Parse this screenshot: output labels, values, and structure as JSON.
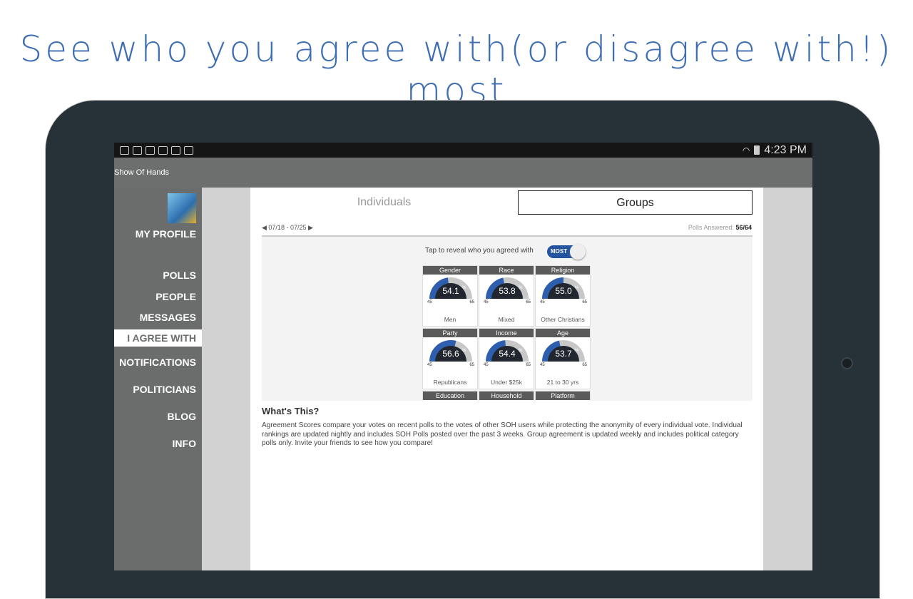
{
  "headline": "See who you agree with(or disagree with!) most",
  "status": {
    "time": "4:23 PM",
    "icons": [
      "cast-icon",
      "screen-clock-icon",
      "image-icon",
      "mail-icon",
      "clipboard-check-icon",
      "clipboard-play-icon"
    ]
  },
  "app": {
    "title": "Show Of Hands"
  },
  "sidebar": {
    "profile": "MY PROFILE",
    "items": [
      {
        "label": "POLLS"
      },
      {
        "label": "PEOPLE"
      },
      {
        "label": "MESSAGES"
      },
      {
        "label": "I AGREE WITH",
        "active": true
      },
      {
        "label": "NOTIFICATIONS"
      },
      {
        "label": "POLITICIANS"
      },
      {
        "label": "BLOG"
      },
      {
        "label": "INFO"
      }
    ]
  },
  "tabs": {
    "individuals": "Individuals",
    "groups": "Groups",
    "selected": "Groups"
  },
  "date_range": "07/18 - 07/25",
  "polls_answered_label": "Polls Answered:",
  "polls_answered": "56/64",
  "reveal_label": "Tap to reveal who you agreed with",
  "toggle_label": "MOST",
  "gauge_min": "45",
  "gauge_max": "65",
  "colors": {
    "accent": "#2e5fae",
    "gauge_track": "#c8c8c8",
    "gauge_center": "#22262e"
  },
  "groups": [
    {
      "category": "Gender",
      "value": "54.1",
      "label": "Men"
    },
    {
      "category": "Race",
      "value": "53.8",
      "label": "Mixed"
    },
    {
      "category": "Religion",
      "value": "55.0",
      "label": "Other Christians"
    },
    {
      "category": "Party",
      "value": "56.6",
      "label": "Republicans"
    },
    {
      "category": "Income",
      "value": "54.4",
      "label": "Under $25k"
    },
    {
      "category": "Age",
      "value": "53.7",
      "label": "21 to 30 yrs"
    },
    {
      "category": "Education"
    },
    {
      "category": "Household"
    },
    {
      "category": "Platform"
    }
  ],
  "whats_this": {
    "title": "What's This?",
    "text": "Agreement Scores compare your votes on recent polls to the votes of other SOH users while protecting the anonymity of every individual vote. Individual rankings are updated nightly and includes SOH Polls posted over the past 3 weeks.  Group agreement is updated weekly and includes political category polls only.  Invite your friends to see how you compare!"
  }
}
